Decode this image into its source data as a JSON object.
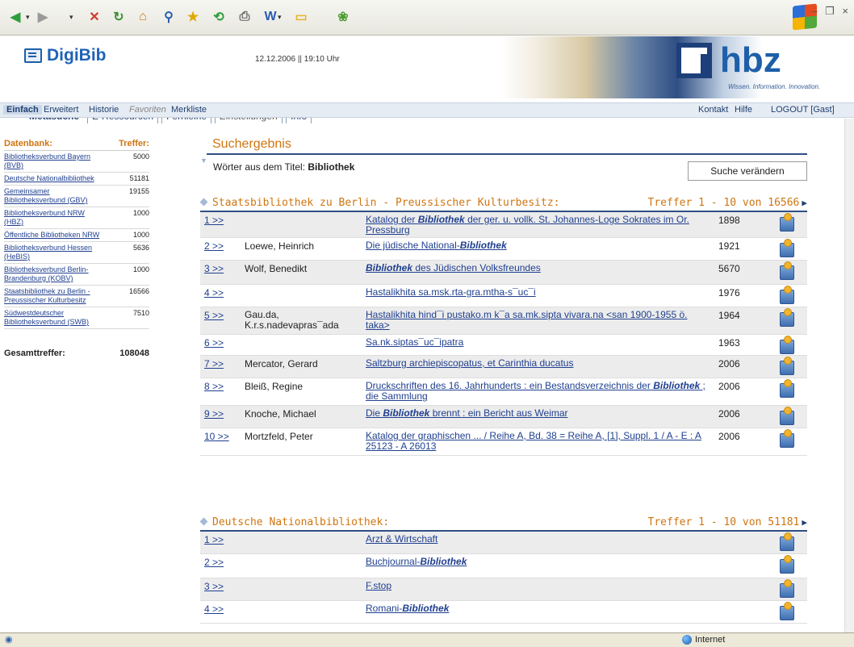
{
  "toolbar": {
    "buttons": [
      {
        "name": "back-button",
        "icon": "back-arrow-icon",
        "glyph": "◀",
        "color": "#2e9d3b"
      },
      {
        "name": "forward-button",
        "icon": "forward-arrow-icon",
        "glyph": "▶",
        "color": "#9a9a9a"
      },
      {
        "name": "stop-button",
        "icon": "stop-icon",
        "glyph": "✕",
        "color": "#d33b2c"
      },
      {
        "name": "refresh-button",
        "icon": "refresh-icon",
        "glyph": "↻",
        "color": "#3f8f34"
      },
      {
        "name": "home-button",
        "icon": "home-icon",
        "glyph": "⌂",
        "color": "#d07510"
      },
      {
        "name": "search-button",
        "icon": "search-icon",
        "glyph": "⚲",
        "color": "#2a5db0"
      },
      {
        "name": "favorites-button",
        "icon": "star-icon",
        "glyph": "★",
        "color": "#e0a800"
      },
      {
        "name": "history-button",
        "icon": "history-icon",
        "glyph": "⟲",
        "color": "#2e9d3b"
      },
      {
        "name": "print-button",
        "icon": "printer-icon",
        "glyph": "⎙",
        "color": "#666666"
      },
      {
        "name": "word-button",
        "icon": "word-icon",
        "glyph": "W",
        "color": "#2a5db0"
      },
      {
        "name": "folder-button",
        "icon": "folder-icon",
        "glyph": "▭",
        "color": "#e5b42f"
      },
      {
        "name": "plugin-button",
        "icon": "flower-icon",
        "glyph": "❀",
        "color": "#4d9e32"
      }
    ]
  },
  "header": {
    "logo": "DigiBib",
    "datetime": "12.12.2006 || 19:10 Uhr",
    "hbz_logo": "hbz",
    "hbz_tagline": "Wissen. Information. Innovation."
  },
  "tabs": [
    {
      "label": "Metasuche",
      "active": true
    },
    {
      "label": "E-Ressourcen"
    },
    {
      "label": "Fernleihe"
    },
    {
      "label": "Einstellungen",
      "muted": true
    },
    {
      "label": "Info"
    }
  ],
  "subnav": {
    "left": [
      "Einfach",
      "Erweitert",
      "Historie",
      "Favoriten",
      "Merkliste"
    ],
    "right": [
      "Kontakt",
      "Hilfe",
      "LOGOUT [Gast]"
    ]
  },
  "sidebar": {
    "col_db": "Datenbank:",
    "col_hits": "Treffer:",
    "rows": [
      {
        "name": "Bibliotheksverbund Bayern (BVB)",
        "hits": "5000"
      },
      {
        "name": "Deutsche Nationalbibliothek",
        "hits": "51181"
      },
      {
        "name": "Gemeinsamer Bibliotheksverbund (GBV)",
        "hits": "19155"
      },
      {
        "name": "Bibliotheksverbund NRW (HBZ)",
        "hits": "1000"
      },
      {
        "name": "Öffentliche Bibliotheken NRW",
        "hits": "1000"
      },
      {
        "name": "Bibliotheksverbund Hessen (HeBIS)",
        "hits": "5636"
      },
      {
        "name": "Bibliotheksverbund Berlin-Brandenburg (KOBV)",
        "hits": "1000"
      },
      {
        "name": "Staatsbibliothek zu Berlin - Preussischer Kulturbesitz",
        "hits": "16566"
      },
      {
        "name": "Südwestdeutscher Bibliotheksverbund (SWB)",
        "hits": "7510"
      }
    ],
    "total_label": "Gesamttreffer:",
    "total_value": "108048"
  },
  "search": {
    "title": "Suchergebnis",
    "query_label": "Wörter aus dem Titel:",
    "query_value": "Bibliothek",
    "change_button": "Suche verändern"
  },
  "sections": [
    {
      "title": "Staatsbibliothek zu Berlin - Preussischer Kulturbesitz:",
      "range": "Treffer 1 - 10 von 16566",
      "rows": [
        {
          "num": "1 >>",
          "author": "",
          "pre": "Katalog der ",
          "hl": "Bibliothek",
          "post": " der ger. u. vollk. St. Johannes-Loge Sokrates im Or. Pressburg",
          "year": "1898",
          "shade": true
        },
        {
          "num": "2 >>",
          "author": "Loewe, Heinrich",
          "pre": "Die jüdische National-",
          "hl": "Bibliothek",
          "post": "",
          "year": "1921",
          "shade": false
        },
        {
          "num": "3 >>",
          "author": "Wolf, Benedikt",
          "pre": "",
          "hl": "Bibliothek",
          "post": " des Jüdischen Volksfreundes",
          "year": "5670",
          "shade": true
        },
        {
          "num": "4 >>",
          "author": "",
          "pre": "Hastalikhita sa.msk.rta-gra.mtha-s¯uc¯i",
          "hl": "",
          "post": "",
          "year": "1976",
          "shade": false
        },
        {
          "num": "5 >>",
          "author": "Gau.da, K.r.s.nadevapras¯ada",
          "pre": "Hastalikhita hind¯i pustako.m k¯a sa.mk.sipta vivara.na <san 1900-1955 ö. taka>",
          "hl": "",
          "post": "",
          "year": "1964",
          "shade": true
        },
        {
          "num": "6 >>",
          "author": "",
          "pre": "Sa.nk.siptas¯uc¯ipatra",
          "hl": "",
          "post": "",
          "year": "1963",
          "shade": false
        },
        {
          "num": "7 >>",
          "author": "Mercator, Gerard",
          "pre": "Saltzburg archiepiscopatus, et Carinthia ducatus",
          "hl": "",
          "post": "",
          "year": "2006",
          "shade": true
        },
        {
          "num": "8 >>",
          "author": "Bleiß, Regine",
          "pre": "Druckschriften des 16. Jahrhunderts : ein Bestandsverzeichnis der ",
          "hl": "Bibliothek",
          "post": " ; die Sammlung",
          "year": "2006",
          "shade": false
        },
        {
          "num": "9 >>",
          "author": "Knoche, Michael",
          "pre": "Die ",
          "hl": "Bibliothek",
          "post": " brennt : ein Bericht aus Weimar",
          "year": "2006",
          "shade": true
        },
        {
          "num": "10 >>",
          "author": "Mortzfeld, Peter",
          "pre": "Katalog der graphischen ... / Reihe A, Bd. 38 = Reihe A, [1], Suppl. 1 / A - E : A 25123 - A 26013",
          "hl": "",
          "post": "",
          "year": "2006",
          "shade": false
        }
      ]
    },
    {
      "title": "Deutsche Nationalbibliothek:",
      "range": "Treffer 1 - 10 von 51181",
      "rows": [
        {
          "num": "1 >>",
          "author": "",
          "pre": "Arzt & Wirtschaft",
          "hl": "",
          "post": "",
          "year": "",
          "shade": true
        },
        {
          "num": "2 >>",
          "author": "",
          "pre": "Buchjournal-",
          "hl": "Bibliothek",
          "post": "",
          "year": "",
          "shade": false
        },
        {
          "num": "3 >>",
          "author": "",
          "pre": "F.stop",
          "hl": "",
          "post": "",
          "year": "",
          "shade": true
        },
        {
          "num": "4 >>",
          "author": "",
          "pre": "Romani-",
          "hl": "Bibliothek",
          "post": "",
          "year": "",
          "shade": false
        }
      ]
    }
  ],
  "statusbar": {
    "zone": "Internet"
  },
  "colors": {
    "accent_orange": "#d07510",
    "link_blue": "#1f3f8f",
    "rule_blue": "#2f4f84"
  }
}
